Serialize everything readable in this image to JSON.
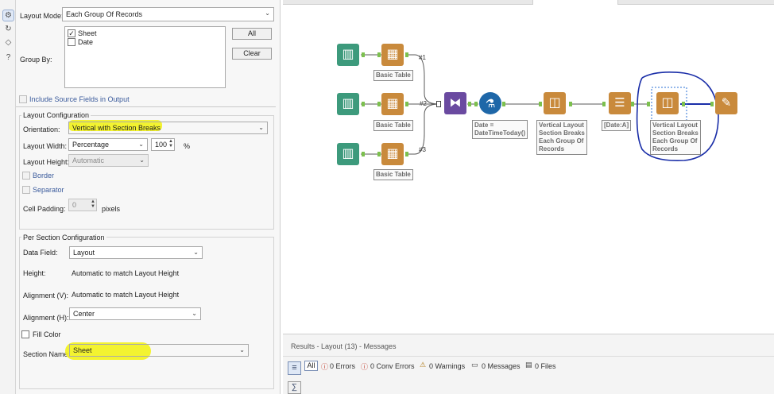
{
  "config": {
    "layout_mode_label": "Layout Mode:",
    "layout_mode_value": "Each Group Of Records",
    "group_by_label": "Group By:",
    "group_by_items": [
      {
        "label": "Sheet",
        "checked": true
      },
      {
        "label": "Date",
        "checked": false
      }
    ],
    "all_button": "All",
    "clear_button": "Clear",
    "include_source": "Include Source Fields in Output",
    "layout_config_title": "Layout Configuration",
    "orientation_label": "Orientation:",
    "orientation_value": "Vertical with Section Breaks",
    "layout_width_label": "Layout Width:",
    "layout_width_value": "Percentage",
    "layout_width_number": "100",
    "percent_sign": "%",
    "layout_height_label": "Layout Height:",
    "layout_height_value": "Automatic",
    "border_label": "Border",
    "separator_label": "Separator",
    "cell_padding_label": "Cell Padding:",
    "cell_padding_value": "0",
    "pixels_label": "pixels",
    "per_section_title": "Per Section Configuration",
    "data_field_label": "Data Field:",
    "data_field_value": "Layout",
    "height_label": "Height:",
    "height_value": "Automatic to match Layout Height",
    "alignment_v_label": "Alignment (V):",
    "alignment_v_value": "Automatic to match Layout Height",
    "alignment_h_label": "Alignment (H):",
    "alignment_h_value": "Center",
    "fill_color_label": "Fill Color",
    "section_name_label": "Section Name:",
    "section_name_value": "Sheet"
  },
  "canvas": {
    "basic_table_1": "Basic Table",
    "basic_table_2": "Basic Table",
    "basic_table_3": "Basic Table",
    "conn_1": "#1",
    "conn_2": "#2",
    "conn_3": "#3",
    "formula_line1": "Date =",
    "formula_line2": "DateTimeToday()",
    "layout1_line1": "Vertical Layout",
    "layout1_line2": "Section Breaks",
    "layout1_line3": "Each Group Of",
    "layout1_line4": "Records",
    "sort_label": "[Date:A]",
    "layout2_line1": "Vertical Layout",
    "layout2_line2": "Section Breaks",
    "layout2_line3": "Each Group Of",
    "layout2_line4": "Records"
  },
  "results": {
    "title": "Results - Layout (13) - Messages",
    "all": "All",
    "errors": "0 Errors",
    "conv_errors": "0 Conv Errors",
    "warnings": "0 Warnings",
    "messages": "0 Messages",
    "files": "0 Files"
  },
  "colors": {
    "input_green": "#3d9a7c",
    "table_orange": "#c98a3c",
    "transpose_purple": "#6a4aa0",
    "formula_blue": "#1e67a8",
    "highlight_yellow": "#f2f21a",
    "annotation_navy": "#1a2ea8"
  }
}
